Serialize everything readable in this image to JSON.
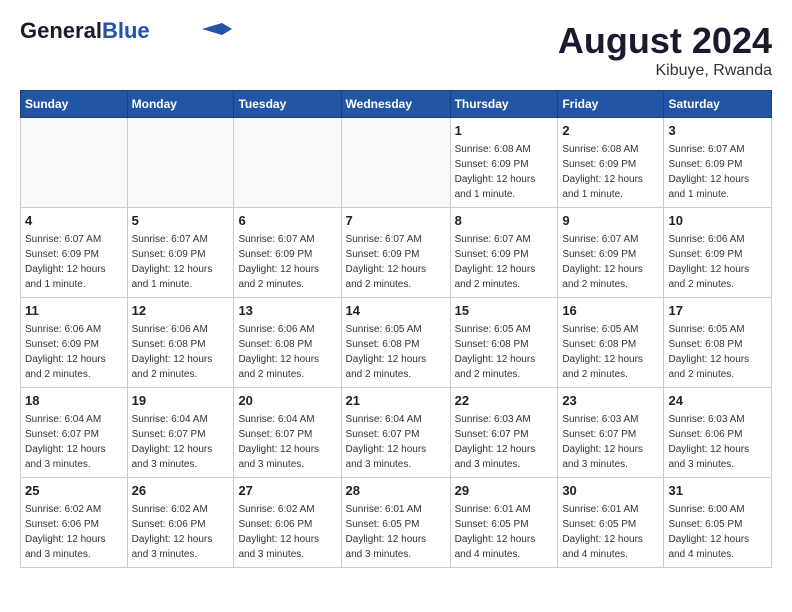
{
  "header": {
    "logo_line1": "General",
    "logo_line2": "Blue",
    "title": "August 2024",
    "location": "Kibuye, Rwanda"
  },
  "weekdays": [
    "Sunday",
    "Monday",
    "Tuesday",
    "Wednesday",
    "Thursday",
    "Friday",
    "Saturday"
  ],
  "weeks": [
    [
      {
        "day": "",
        "info": ""
      },
      {
        "day": "",
        "info": ""
      },
      {
        "day": "",
        "info": ""
      },
      {
        "day": "",
        "info": ""
      },
      {
        "day": "1",
        "info": "Sunrise: 6:08 AM\nSunset: 6:09 PM\nDaylight: 12 hours\nand 1 minute."
      },
      {
        "day": "2",
        "info": "Sunrise: 6:08 AM\nSunset: 6:09 PM\nDaylight: 12 hours\nand 1 minute."
      },
      {
        "day": "3",
        "info": "Sunrise: 6:07 AM\nSunset: 6:09 PM\nDaylight: 12 hours\nand 1 minute."
      }
    ],
    [
      {
        "day": "4",
        "info": "Sunrise: 6:07 AM\nSunset: 6:09 PM\nDaylight: 12 hours\nand 1 minute."
      },
      {
        "day": "5",
        "info": "Sunrise: 6:07 AM\nSunset: 6:09 PM\nDaylight: 12 hours\nand 1 minute."
      },
      {
        "day": "6",
        "info": "Sunrise: 6:07 AM\nSunset: 6:09 PM\nDaylight: 12 hours\nand 2 minutes."
      },
      {
        "day": "7",
        "info": "Sunrise: 6:07 AM\nSunset: 6:09 PM\nDaylight: 12 hours\nand 2 minutes."
      },
      {
        "day": "8",
        "info": "Sunrise: 6:07 AM\nSunset: 6:09 PM\nDaylight: 12 hours\nand 2 minutes."
      },
      {
        "day": "9",
        "info": "Sunrise: 6:07 AM\nSunset: 6:09 PM\nDaylight: 12 hours\nand 2 minutes."
      },
      {
        "day": "10",
        "info": "Sunrise: 6:06 AM\nSunset: 6:09 PM\nDaylight: 12 hours\nand 2 minutes."
      }
    ],
    [
      {
        "day": "11",
        "info": "Sunrise: 6:06 AM\nSunset: 6:09 PM\nDaylight: 12 hours\nand 2 minutes."
      },
      {
        "day": "12",
        "info": "Sunrise: 6:06 AM\nSunset: 6:08 PM\nDaylight: 12 hours\nand 2 minutes."
      },
      {
        "day": "13",
        "info": "Sunrise: 6:06 AM\nSunset: 6:08 PM\nDaylight: 12 hours\nand 2 minutes."
      },
      {
        "day": "14",
        "info": "Sunrise: 6:05 AM\nSunset: 6:08 PM\nDaylight: 12 hours\nand 2 minutes."
      },
      {
        "day": "15",
        "info": "Sunrise: 6:05 AM\nSunset: 6:08 PM\nDaylight: 12 hours\nand 2 minutes."
      },
      {
        "day": "16",
        "info": "Sunrise: 6:05 AM\nSunset: 6:08 PM\nDaylight: 12 hours\nand 2 minutes."
      },
      {
        "day": "17",
        "info": "Sunrise: 6:05 AM\nSunset: 6:08 PM\nDaylight: 12 hours\nand 2 minutes."
      }
    ],
    [
      {
        "day": "18",
        "info": "Sunrise: 6:04 AM\nSunset: 6:07 PM\nDaylight: 12 hours\nand 3 minutes."
      },
      {
        "day": "19",
        "info": "Sunrise: 6:04 AM\nSunset: 6:07 PM\nDaylight: 12 hours\nand 3 minutes."
      },
      {
        "day": "20",
        "info": "Sunrise: 6:04 AM\nSunset: 6:07 PM\nDaylight: 12 hours\nand 3 minutes."
      },
      {
        "day": "21",
        "info": "Sunrise: 6:04 AM\nSunset: 6:07 PM\nDaylight: 12 hours\nand 3 minutes."
      },
      {
        "day": "22",
        "info": "Sunrise: 6:03 AM\nSunset: 6:07 PM\nDaylight: 12 hours\nand 3 minutes."
      },
      {
        "day": "23",
        "info": "Sunrise: 6:03 AM\nSunset: 6:07 PM\nDaylight: 12 hours\nand 3 minutes."
      },
      {
        "day": "24",
        "info": "Sunrise: 6:03 AM\nSunset: 6:06 PM\nDaylight: 12 hours\nand 3 minutes."
      }
    ],
    [
      {
        "day": "25",
        "info": "Sunrise: 6:02 AM\nSunset: 6:06 PM\nDaylight: 12 hours\nand 3 minutes."
      },
      {
        "day": "26",
        "info": "Sunrise: 6:02 AM\nSunset: 6:06 PM\nDaylight: 12 hours\nand 3 minutes."
      },
      {
        "day": "27",
        "info": "Sunrise: 6:02 AM\nSunset: 6:06 PM\nDaylight: 12 hours\nand 3 minutes."
      },
      {
        "day": "28",
        "info": "Sunrise: 6:01 AM\nSunset: 6:05 PM\nDaylight: 12 hours\nand 3 minutes."
      },
      {
        "day": "29",
        "info": "Sunrise: 6:01 AM\nSunset: 6:05 PM\nDaylight: 12 hours\nand 4 minutes."
      },
      {
        "day": "30",
        "info": "Sunrise: 6:01 AM\nSunset: 6:05 PM\nDaylight: 12 hours\nand 4 minutes."
      },
      {
        "day": "31",
        "info": "Sunrise: 6:00 AM\nSunset: 6:05 PM\nDaylight: 12 hours\nand 4 minutes."
      }
    ]
  ]
}
